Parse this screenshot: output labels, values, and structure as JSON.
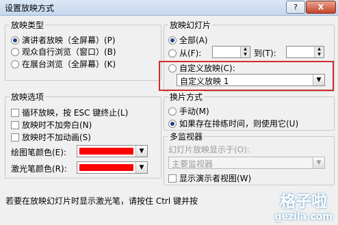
{
  "window": {
    "title": "设置放映方式",
    "help_label": "?",
    "close_label": "X"
  },
  "show_type": {
    "label": "放映类型",
    "options": [
      "演讲者放映（全屏幕）(P)",
      "观众自行浏览（窗口）(B)",
      "在展台浏览（全屏幕）(K)"
    ]
  },
  "slides": {
    "label": "放映幻灯片",
    "all": "全部(A)",
    "from": "从(F):",
    "from_value": "",
    "to": "到(T):",
    "to_value": "",
    "custom": "自定义放映(C):",
    "custom_value": "自定义放映 1"
  },
  "options": {
    "label": "放映选项",
    "loop": "循环放映，按 ESC 键终止(L)",
    "no_narration": "放映时不加旁白(N)",
    "no_animation": "放映时不加动画(S)",
    "pen_color": "绘图笔颜色(E):",
    "laser_color": "激光笔颜色(R):",
    "swatch_color": "#ff0000"
  },
  "advance": {
    "label": "换片方式",
    "manual": "手动(M)",
    "timings": "如果存在排练时间，则使用它(U)"
  },
  "monitors": {
    "label": "多监视器",
    "display_label": "幻灯片放映显示于(O):",
    "display_value": "主要监视器",
    "presenter_view": "显示演示者视图(W)"
  },
  "status": {
    "hint": "若要在放映幻灯片时显示激光笔，请按住 Ctrl 键并按"
  },
  "watermark": {
    "line1": "格子啦",
    "line2": "gezila.com"
  }
}
